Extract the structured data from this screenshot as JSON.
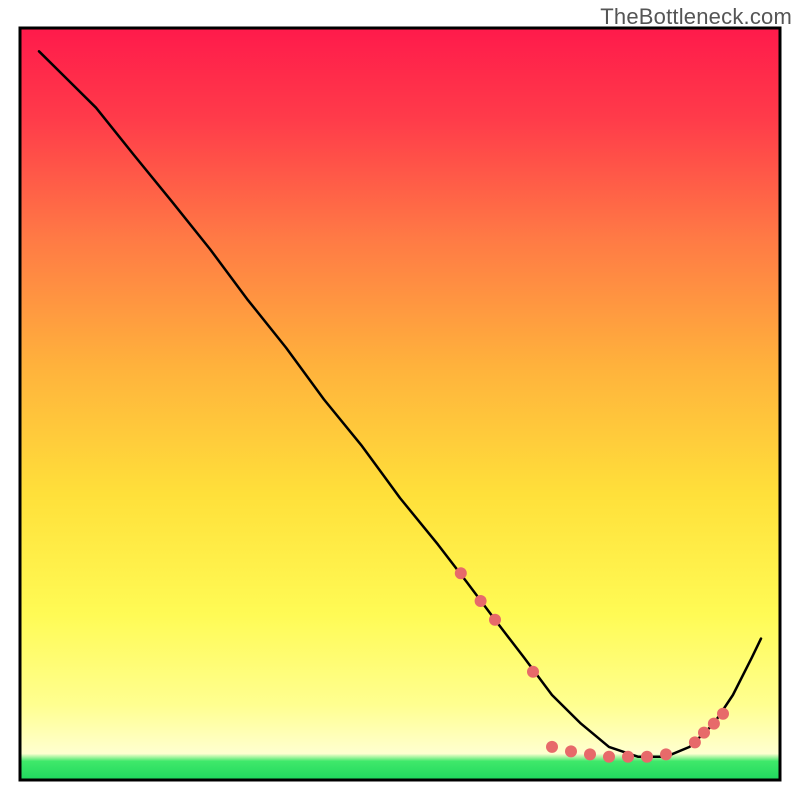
{
  "watermark": "TheBottleneck.com",
  "chart_data": {
    "type": "line",
    "title": "",
    "xlabel": "",
    "ylabel": "",
    "xlim": [
      0,
      100
    ],
    "ylim": [
      0,
      100
    ],
    "grid": false,
    "series": [
      {
        "name": "curve",
        "x": [
          2.5,
          6.3,
          10.0,
          15.0,
          20.0,
          25.0,
          30.0,
          35.0,
          40.0,
          45.0,
          50.0,
          55.0,
          58.8,
          62.5,
          66.3,
          70.0,
          73.8,
          77.5,
          81.3,
          85.0,
          88.1,
          91.3,
          93.8,
          96.3,
          97.5
        ],
        "y": [
          96.9,
          93.1,
          89.4,
          83.1,
          76.9,
          70.6,
          63.8,
          57.5,
          50.6,
          44.4,
          37.5,
          31.3,
          26.3,
          21.3,
          16.3,
          11.3,
          7.5,
          4.4,
          3.1,
          3.1,
          4.4,
          7.5,
          11.3,
          16.3,
          18.8
        ]
      }
    ],
    "optimal_band": {
      "y_min": 0,
      "y_max": 5
    },
    "markers": [
      {
        "x": 58.0,
        "y": 27.5
      },
      {
        "x": 60.6,
        "y": 23.8
      },
      {
        "x": 62.5,
        "y": 21.3
      },
      {
        "x": 67.5,
        "y": 14.4
      },
      {
        "x": 70.0,
        "y": 4.4
      },
      {
        "x": 72.5,
        "y": 3.8
      },
      {
        "x": 75.0,
        "y": 3.4
      },
      {
        "x": 77.5,
        "y": 3.1
      },
      {
        "x": 80.0,
        "y": 3.1
      },
      {
        "x": 82.5,
        "y": 3.1
      },
      {
        "x": 85.0,
        "y": 3.4
      },
      {
        "x": 88.8,
        "y": 5.0
      },
      {
        "x": 90.0,
        "y": 6.3
      },
      {
        "x": 91.3,
        "y": 7.5
      },
      {
        "x": 92.5,
        "y": 8.8
      }
    ],
    "gradient_stops": [
      {
        "offset": 0.0,
        "color": "#ff1a4b"
      },
      {
        "offset": 0.12,
        "color": "#ff3b4a"
      },
      {
        "offset": 0.28,
        "color": "#ff7a45"
      },
      {
        "offset": 0.45,
        "color": "#ffb23c"
      },
      {
        "offset": 0.62,
        "color": "#ffe03a"
      },
      {
        "offset": 0.78,
        "color": "#fffb55"
      },
      {
        "offset": 0.9,
        "color": "#ffff90"
      },
      {
        "offset": 0.965,
        "color": "#ffffd0"
      },
      {
        "offset": 0.975,
        "color": "#3fe86a"
      },
      {
        "offset": 1.0,
        "color": "#1fd85e"
      }
    ]
  }
}
